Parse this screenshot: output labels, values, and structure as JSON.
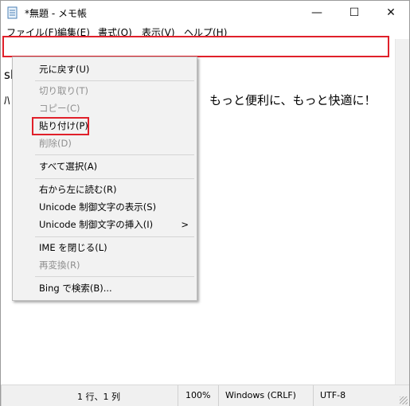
{
  "window": {
    "title": "*無題 - メモ帳"
  },
  "titlebar": {
    "minimize": "—",
    "maximize": "☐",
    "close": "✕"
  },
  "menubar": {
    "items": [
      "ファイル(F)",
      "編集(E)",
      "書式(O)",
      "表示(V)",
      "ヘルプ(H)"
    ]
  },
  "editor": {
    "line1": "",
    "line2_prefix": "sl",
    "line3_prefix": "ﾊ",
    "line3_suffix": "もっと便利に、もっと快適に！"
  },
  "context_menu": {
    "undo": "元に戻す(U)",
    "cut": "切り取り(T)",
    "copy": "コピー(C)",
    "paste": "貼り付け(P)",
    "delete": "削除(D)",
    "select_all": "すべて選択(A)",
    "rtl": "右から左に読む(R)",
    "show_unicode": "Unicode 制御文字の表示(S)",
    "insert_unicode": "Unicode 制御文字の挿入(I)",
    "submenu_arrow": ">",
    "close_ime": "IME を閉じる(L)",
    "reconvert": "再変換(R)",
    "bing": "Bing で検索(B)..."
  },
  "statusbar": {
    "position": "1 行、1 列",
    "zoom": "100%",
    "line_ending": "Windows (CRLF)",
    "encoding": "UTF-8"
  },
  "colors": {
    "highlight": "#e0202a",
    "menu_bg": "#f2f2f2",
    "disabled": "#8f8f8f"
  }
}
